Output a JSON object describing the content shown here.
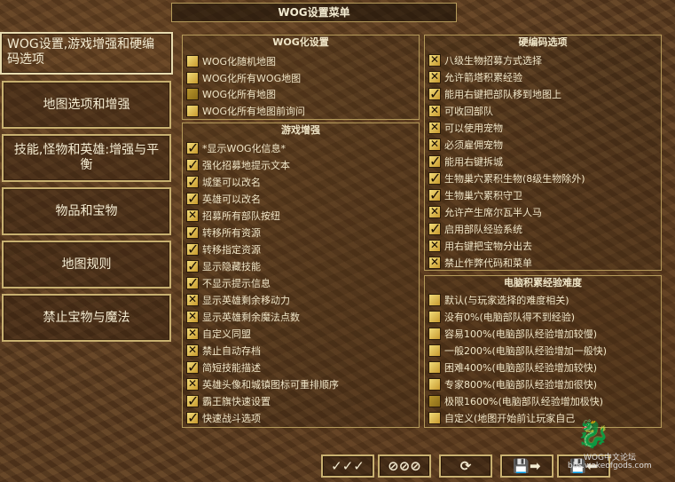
{
  "window": {
    "title": "WOG设置菜单"
  },
  "sidebar": {
    "items": [
      {
        "label": "WOG设置,游戏增强和硬编码选项"
      },
      {
        "label": "地图选项和增强"
      },
      {
        "label": "技能,怪物和英雄:增强与平衡"
      },
      {
        "label": "物品和宝物"
      },
      {
        "label": "地图规则"
      },
      {
        "label": "禁止宝物与魔法"
      }
    ]
  },
  "wog_panel": {
    "title": "WOG化设置",
    "items": [
      {
        "label": "WOG化随机地图",
        "state": "empty"
      },
      {
        "label": "WOG化所有WOG地图",
        "state": "empty"
      },
      {
        "label": "WOG化所有地图",
        "state": "dot"
      },
      {
        "label": "WOG化所有地图前询问",
        "state": "empty"
      }
    ]
  },
  "enhance_panel": {
    "title": "游戏增强",
    "items": [
      {
        "label": "*显示WOG化信息*",
        "state": "on"
      },
      {
        "label": "强化招募地提示文本",
        "state": "on"
      },
      {
        "label": "城堡可以改名",
        "state": "on"
      },
      {
        "label": "英雄可以改名",
        "state": "on"
      },
      {
        "label": "招募所有部队按纽",
        "state": "x"
      },
      {
        "label": "转移所有资源",
        "state": "on"
      },
      {
        "label": "转移指定资源",
        "state": "on"
      },
      {
        "label": "显示隐藏技能",
        "state": "on"
      },
      {
        "label": "不显示提示信息",
        "state": "on"
      },
      {
        "label": "显示英雄剩余移动力",
        "state": "x"
      },
      {
        "label": "显示英雄剩余魔法点数",
        "state": "x"
      },
      {
        "label": "自定义同盟",
        "state": "x"
      },
      {
        "label": "禁止自动存档",
        "state": "x"
      },
      {
        "label": "简短技能描述",
        "state": "on"
      },
      {
        "label": "英雄头像和城镇图标可重排顺序",
        "state": "x"
      },
      {
        "label": "霸王旗快速设置",
        "state": "on"
      },
      {
        "label": "快速战斗选项",
        "state": "on"
      }
    ]
  },
  "hardcode_panel": {
    "title": "硬编码选项",
    "items": [
      {
        "label": "八级生物招募方式选择",
        "state": "x"
      },
      {
        "label": "允许箭塔积累经验",
        "state": "x"
      },
      {
        "label": "能用右键把部队移到地图上",
        "state": "on"
      },
      {
        "label": "可收回部队",
        "state": "x"
      },
      {
        "label": "可以使用宠物",
        "state": "x"
      },
      {
        "label": "必须雇佣宠物",
        "state": "x"
      },
      {
        "label": "能用右键拆城",
        "state": "on"
      },
      {
        "label": "生物巢穴累积生物(8级生物除外)",
        "state": "on"
      },
      {
        "label": "生物巢穴累积守卫",
        "state": "on"
      },
      {
        "label": "允许产生席尔瓦半人马",
        "state": "x"
      },
      {
        "label": "启用部队经验系统",
        "state": "on"
      },
      {
        "label": "用右键把宝物分出去",
        "state": "x"
      },
      {
        "label": "禁止作弊代码和菜单",
        "state": "x"
      }
    ]
  },
  "ai_panel": {
    "title": "电脑积累经验难度",
    "items": [
      {
        "label": "默认(与玩家选择的难度相关)",
        "state": "empty"
      },
      {
        "label": "没有0%(电脑部队得不到经验)",
        "state": "empty"
      },
      {
        "label": "容易100%(电脑部队经验增加较慢)",
        "state": "empty"
      },
      {
        "label": "一般200%(电脑部队经验增加一般快)",
        "state": "empty"
      },
      {
        "label": "困难400%(电脑部队经验增加较快)",
        "state": "empty"
      },
      {
        "label": "专家800%(电脑部队经验增加很快)",
        "state": "empty"
      },
      {
        "label": "极限1600%(电脑部队经验增加极快)",
        "state": "dot"
      },
      {
        "label": "自定义(地图开始前让玩家自己",
        "state": "empty"
      }
    ]
  },
  "bottom": {
    "check_all": "✓✓✓",
    "clear_all": "⊘⊘⊘",
    "reset": "⟳",
    "save": "💾➡",
    "load": "💾⬅"
  },
  "watermark": {
    "line1": "WOG中文论坛",
    "line2": "bbs.wakeofgods.com"
  },
  "colors": {
    "accent": "#c8b070",
    "text": "#f0e6c8",
    "checkbox": "#e2c04e"
  }
}
